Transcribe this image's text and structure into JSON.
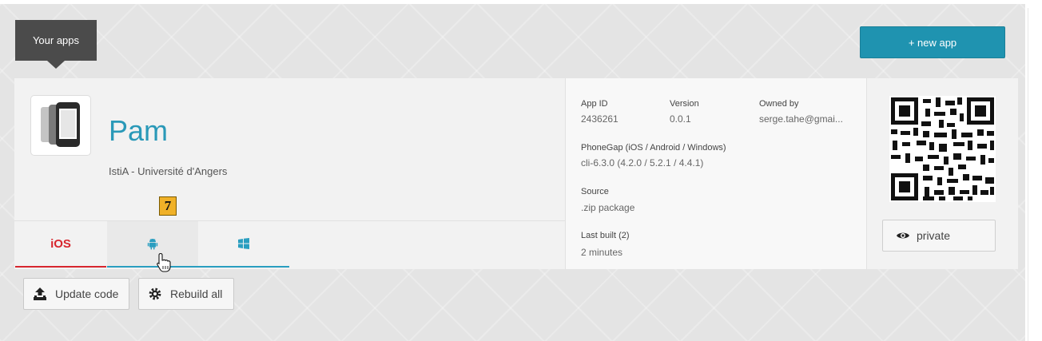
{
  "header": {
    "your_apps_label": "Your apps",
    "new_app_label": "+ new app"
  },
  "app": {
    "name": "Pam",
    "organization": "IstiA - Université d'Angers",
    "annotation_badge": "7",
    "tabs": [
      {
        "label": "iOS",
        "icon": "apple-icon",
        "active": true
      },
      {
        "label": "",
        "icon": "android-icon",
        "active": false
      },
      {
        "label": "",
        "icon": "windows-icon",
        "active": false
      }
    ],
    "info": {
      "app_id_label": "App ID",
      "app_id": "2436261",
      "version_label": "Version",
      "version": "0.0.1",
      "owned_by_label": "Owned by",
      "owned_by": "serge.tahe@gmai...",
      "phonegap_label": "PhoneGap (iOS / Android / Windows)",
      "phonegap_value": "cli-6.3.0 (4.2.0 / 5.2.1 / 4.4.1)",
      "source_label": "Source",
      "source_value": ".zip package",
      "last_built_label": "Last built (2)",
      "last_built_value": "2 minutes"
    },
    "privacy_label": "private",
    "actions": {
      "update_code_label": "Update code",
      "rebuild_all_label": "Rebuild all"
    }
  },
  "colors": {
    "accent_teal": "#1f93b0",
    "ios_red": "#d7262e",
    "android_blue": "#2a9ec0",
    "dark_header": "#4b4b4b"
  }
}
